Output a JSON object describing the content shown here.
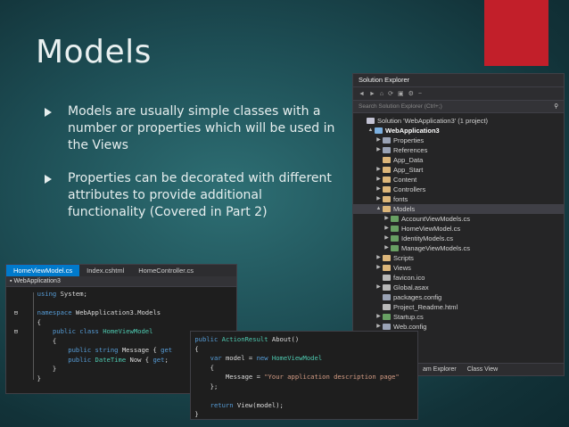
{
  "slide": {
    "title": "Models",
    "accent_color": "#c21f2a",
    "bullets": [
      "Models are usually simple classes with a number or properties which will be used in the Views",
      "Properties can be decorated with different attributes to provide additional functionality (Covered in Part 2)"
    ]
  },
  "solution_explorer": {
    "title": "Solution Explorer",
    "search_placeholder": "Search Solution Explorer (Ctrl+;)",
    "toolbar_icons": [
      "back-icon",
      "forward-icon",
      "home-icon",
      "sync-icon",
      "collapse-icon",
      "properties-icon",
      "pin-icon"
    ],
    "tree": [
      {
        "label": "Solution 'WebApplication3' (1 project)",
        "indent": 0,
        "twisty": "",
        "icon": "sol"
      },
      {
        "label": "WebApplication3",
        "indent": 1,
        "twisty": "▲",
        "icon": "proj",
        "bold": true
      },
      {
        "label": "Properties",
        "indent": 2,
        "twisty": "▶",
        "icon": "cfg"
      },
      {
        "label": "References",
        "indent": 2,
        "twisty": "▶",
        "icon": "cfg"
      },
      {
        "label": "App_Data",
        "indent": 2,
        "twisty": "",
        "icon": "folder"
      },
      {
        "label": "App_Start",
        "indent": 2,
        "twisty": "▶",
        "icon": "folder"
      },
      {
        "label": "Content",
        "indent": 2,
        "twisty": "▶",
        "icon": "folder"
      },
      {
        "label": "Controllers",
        "indent": 2,
        "twisty": "▶",
        "icon": "folder"
      },
      {
        "label": "fonts",
        "indent": 2,
        "twisty": "▶",
        "icon": "folder"
      },
      {
        "label": "Models",
        "indent": 2,
        "twisty": "▲",
        "icon": "folder",
        "selected": true
      },
      {
        "label": "AccountViewModels.cs",
        "indent": 3,
        "twisty": "▶",
        "icon": "cs"
      },
      {
        "label": "HomeViewModel.cs",
        "indent": 3,
        "twisty": "▶",
        "icon": "cs"
      },
      {
        "label": "IdentityModels.cs",
        "indent": 3,
        "twisty": "▶",
        "icon": "cs"
      },
      {
        "label": "ManageViewModels.cs",
        "indent": 3,
        "twisty": "▶",
        "icon": "cs"
      },
      {
        "label": "Scripts",
        "indent": 2,
        "twisty": "▶",
        "icon": "folder"
      },
      {
        "label": "Views",
        "indent": 2,
        "twisty": "▶",
        "icon": "folder"
      },
      {
        "label": "favicon.ico",
        "indent": 2,
        "twisty": "",
        "icon": "file"
      },
      {
        "label": "Global.asax",
        "indent": 2,
        "twisty": "▶",
        "icon": "file"
      },
      {
        "label": "packages.config",
        "indent": 2,
        "twisty": "",
        "icon": "cfg"
      },
      {
        "label": "Project_Readme.html",
        "indent": 2,
        "twisty": "",
        "icon": "file"
      },
      {
        "label": "Startup.cs",
        "indent": 2,
        "twisty": "▶",
        "icon": "cs"
      },
      {
        "label": "Web.config",
        "indent": 2,
        "twisty": "▶",
        "icon": "cfg"
      }
    ],
    "bottom_tabs": [
      "am Explorer",
      "Class View"
    ]
  },
  "editor1": {
    "tabs": [
      "HomeViewModel.cs",
      "Index.cshtml",
      "HomeController.cs"
    ],
    "nav": "WebApplication3"
  },
  "editor2": {}
}
